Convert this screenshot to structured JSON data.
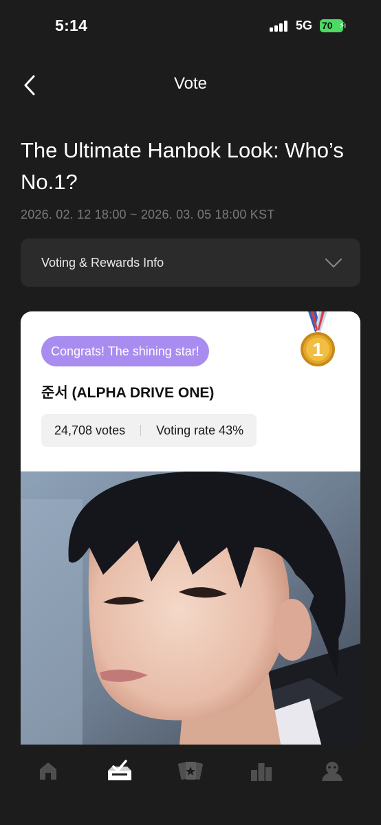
{
  "status_bar": {
    "time": "5:14",
    "network": "5G",
    "battery": "70"
  },
  "header": {
    "title": "Vote"
  },
  "vote": {
    "title": "The Ultimate Hanbok Look: Who’s No.1?",
    "period": "2026. 02. 12 18:00 ~ 2026. 03. 05 18:00 KST"
  },
  "info_accordion": {
    "label": "Voting & Rewards Info"
  },
  "winner": {
    "badge": "Congrats! The shining star!",
    "name": "준서 (ALPHA DRIVE ONE)",
    "votes": "24,708 votes",
    "rate": "Voting rate 43%",
    "medal_number": "1"
  },
  "tab_bar": {
    "items": [
      {
        "icon": "home-icon",
        "active": false
      },
      {
        "icon": "vote-box-icon",
        "active": true
      },
      {
        "icon": "cards-icon",
        "active": false
      },
      {
        "icon": "ranking-icon",
        "active": false
      },
      {
        "icon": "profile-icon",
        "active": false
      }
    ]
  },
  "colors": {
    "background": "#1c1c1c",
    "badge": "#a98cf0",
    "battery": "#4cd964",
    "medal_gold": "#e3a72a"
  }
}
